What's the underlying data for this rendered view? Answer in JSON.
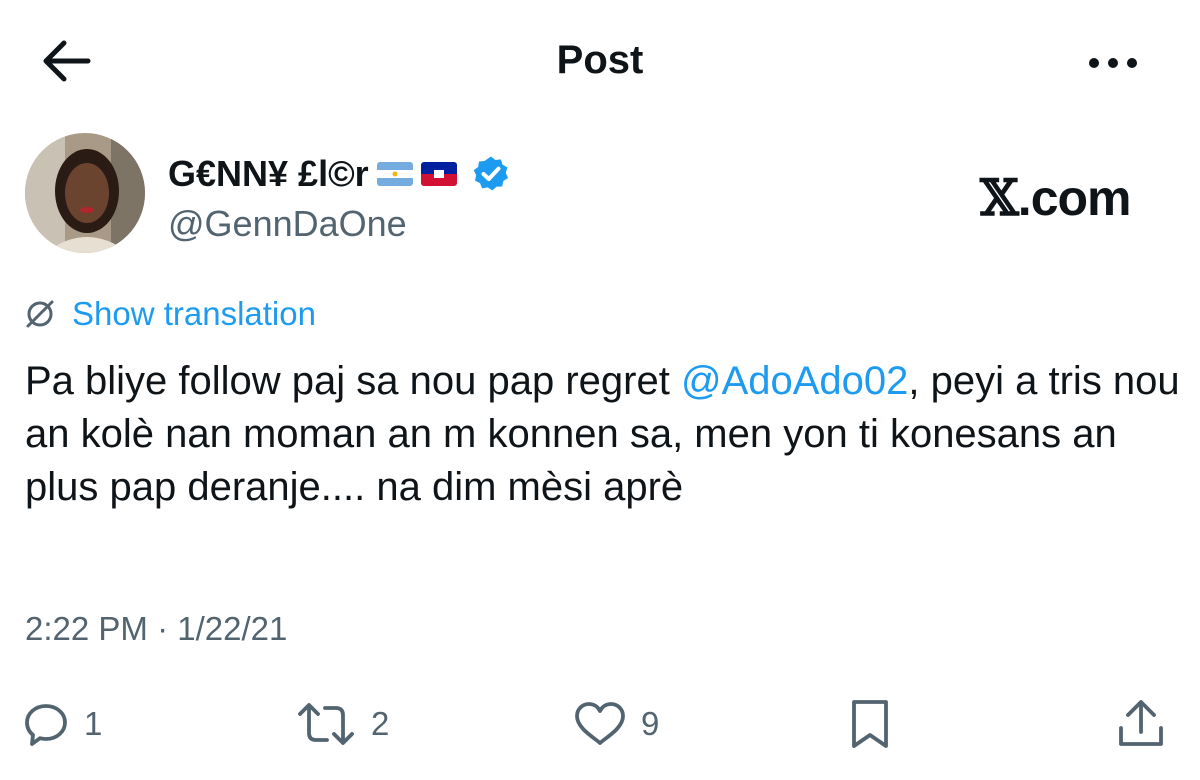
{
  "header": {
    "title": "Post"
  },
  "author": {
    "name": "G€NN¥ £l©r",
    "handle": "@GennDaOne"
  },
  "watermark": {
    "x_glyph": "𝕏",
    "suffix": ".com"
  },
  "translation": {
    "label": "Show translation"
  },
  "post": {
    "text_1": "Pa bliye follow paj sa nou pap regret ",
    "mention": "@AdoAdo02",
    "text_2": ", peyi a tris nou an kolè nan moman an m konnen sa, men yon ti konesans an plus pap deranje.... na dim mèsi aprè",
    "timestamp": "2:22 PM · 1/22/21"
  },
  "actions": {
    "replies": "1",
    "reposts": "2",
    "likes": "9"
  },
  "colors": {
    "accent": "#1d9bf0",
    "muted": "#536471",
    "text": "#0f1419"
  },
  "icons": [
    "back-arrow-icon",
    "more-icon",
    "verified-badge-icon",
    "translate-icon",
    "reply-icon",
    "repost-icon",
    "like-icon",
    "bookmark-icon",
    "share-icon"
  ]
}
